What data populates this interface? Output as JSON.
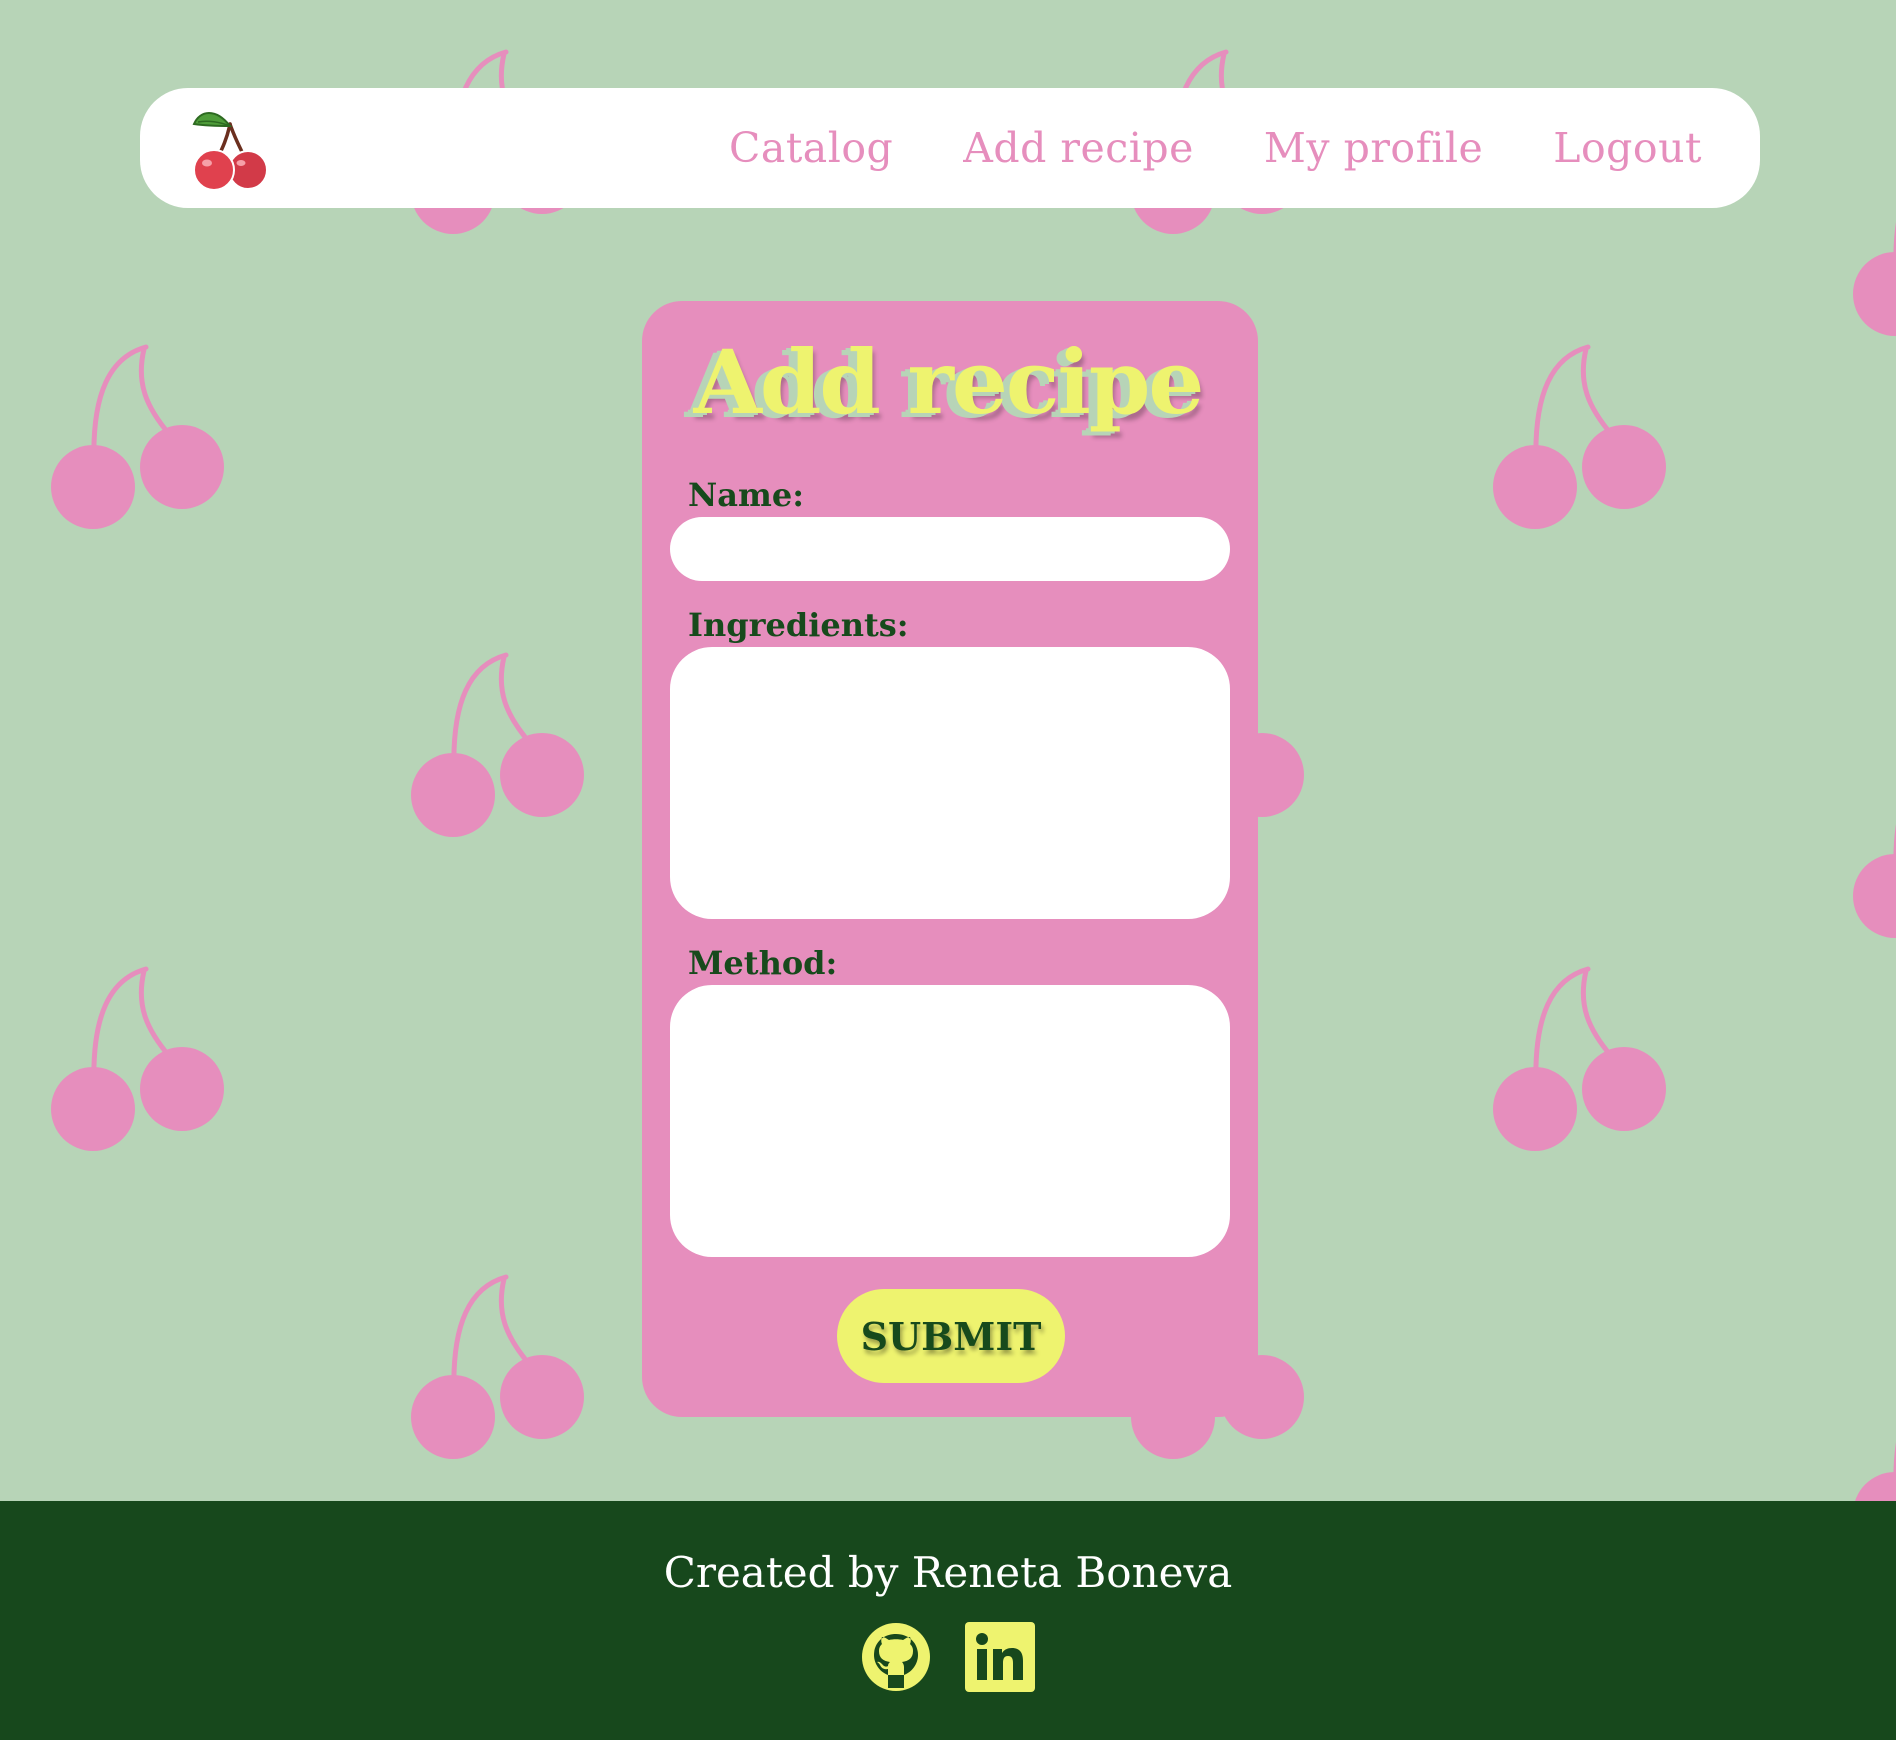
{
  "colors": {
    "background": "#b7d4b7",
    "pattern_cherry": "#e68ebd",
    "navbar": "#ffffff",
    "nav_text": "#e68ebd",
    "card": "#e68ebd",
    "title": "#eef36f",
    "label_text": "#174a1c",
    "submit_bg": "#eef36f",
    "footer_bg": "#17481c",
    "footer_text": "#ffffff",
    "footer_icons": "#eef36f"
  },
  "navbar": {
    "logo_icon": "cherries-icon",
    "links": {
      "catalog": "Catalog",
      "add_recipe": "Add recipe",
      "my_profile": "My profile",
      "logout": "Logout"
    }
  },
  "form": {
    "title": "Add recipe",
    "name": {
      "label": "Name:",
      "value": ""
    },
    "ingredients": {
      "label": "Ingredients:",
      "value": ""
    },
    "method": {
      "label": "Method:",
      "value": ""
    },
    "submit_label": "SUBMIT"
  },
  "footer": {
    "credit": "Created by Reneta Boneva",
    "icons": [
      "github-icon",
      "linkedin-icon"
    ]
  }
}
